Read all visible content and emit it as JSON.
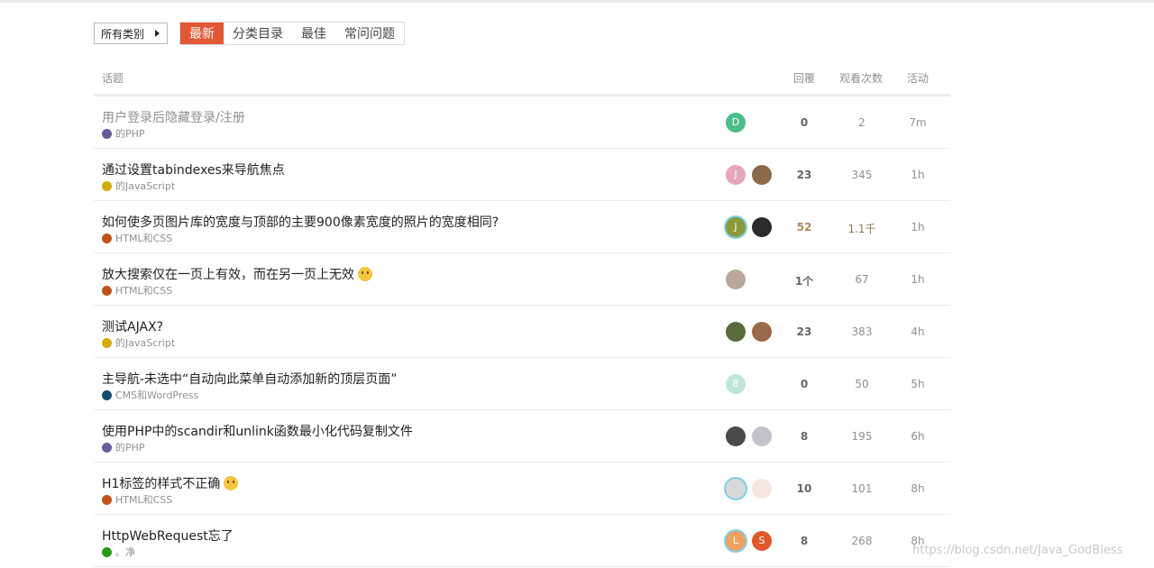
{
  "nav": {
    "category_button": "所有类别",
    "tabs": [
      "最新",
      "分类目录",
      "最佳",
      "常问问题"
    ]
  },
  "table": {
    "headers": {
      "topic": "话题",
      "replies": "回覆",
      "views": "观看次数",
      "activity": "活动"
    }
  },
  "topics": [
    {
      "title": "用户登录后隐藏登录/注册",
      "category": "的PHP",
      "cat_color": "#6a5c9a",
      "replies": "0",
      "views": "2",
      "activity": "7m",
      "avatars": [
        {
          "letter": "D",
          "color": "#4cbf8a"
        }
      ]
    },
    {
      "title": "通过设置tabindexes来导航焦点",
      "category": "的JavaScript",
      "cat_color": "#d4ac0d",
      "replies": "23",
      "views": "345",
      "activity": "1h",
      "avatars": [
        {
          "letter": "J",
          "color": "#e4a6be"
        },
        {
          "letter": "",
          "color": "#8a6a4a"
        }
      ]
    },
    {
      "title": "如何使多页图片库的宽度与顶部的主要900像素宽度的照片的宽度相同?",
      "category": "HTML和CSS",
      "cat_color": "#c2521c",
      "replies": "52",
      "views": "1.1千",
      "activity": "1h",
      "avatars": [
        {
          "letter": "J",
          "color": "#8a9a3a"
        },
        {
          "letter": "",
          "color": "#2a2a2a"
        }
      ]
    },
    {
      "title": "放大搜索仅在一页上有效，而在另一页上无效",
      "category": "HTML和CSS",
      "cat_color": "#c2521c",
      "replies": "1个",
      "views": "67",
      "activity": "1h",
      "avatars": [
        {
          "letter": "",
          "color": "#b9a896"
        }
      ]
    },
    {
      "title": "测试AJAX?",
      "category": "的JavaScript",
      "cat_color": "#d4ac0d",
      "replies": "23",
      "views": "383",
      "activity": "4h",
      "avatars": [
        {
          "letter": "",
          "color": "#5a6a3a"
        },
        {
          "letter": "",
          "color": "#9a6a4a"
        }
      ]
    },
    {
      "title": "主导航-未选中“自动向此菜单自动添加新的顶层页面”",
      "category": "CMS和WordPress",
      "cat_color": "#1a4a6a",
      "replies": "0",
      "views": "50",
      "activity": "5h",
      "avatars": [
        {
          "letter": "8",
          "color": "#bfe6d6"
        }
      ]
    },
    {
      "title": "使用PHP中的scandir和unlink函数最小化代码复制文件",
      "category": "的PHP",
      "cat_color": "#6a5c9a",
      "replies": "8",
      "views": "195",
      "activity": "6h",
      "avatars": [
        {
          "letter": "",
          "color": "#4a4a4a"
        },
        {
          "letter": "",
          "color": "#c2c2ca"
        }
      ]
    },
    {
      "title": "H1标签的样式不正确",
      "category": "HTML和CSS",
      "cat_color": "#c2521c",
      "replies": "10",
      "views": "101",
      "activity": "8h",
      "avatars": [
        {
          "letter": "",
          "color": "#d8d8d8"
        },
        {
          "letter": "",
          "color": "#f7e6e0"
        }
      ]
    },
    {
      "title": "HttpWebRequest忘了",
      "category": "。净",
      "cat_color": "#2a9a1a",
      "replies": "8",
      "views": "268",
      "activity": "8h",
      "avatars": [
        {
          "letter": "L",
          "color": "#f0a061"
        },
        {
          "letter": "S",
          "color": "#e0582a"
        }
      ]
    }
  ],
  "watermark": "https://blog.csdn.net/Java_GodBless"
}
